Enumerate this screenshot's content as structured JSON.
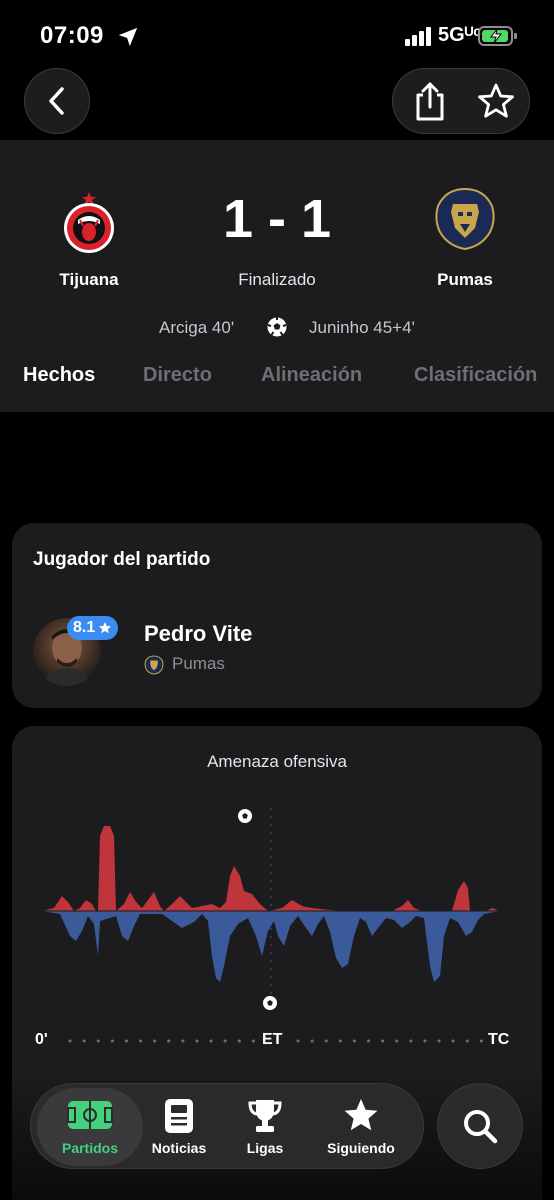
{
  "status_bar": {
    "time": "07:09",
    "network": "5Gᵁᶜ"
  },
  "header": {
    "home_team": {
      "name": "Tijuana",
      "logo_icon": "tijuana-crest-icon"
    },
    "away_team": {
      "name": "Pumas",
      "logo_icon": "pumas-crest-icon"
    },
    "score": "1 - 1",
    "status": "Finalizado",
    "home_scorer": "Arciga 40'",
    "away_scorer": "Juninho 45+4'"
  },
  "tabs": [
    {
      "label": "Hechos",
      "active": true
    },
    {
      "label": "Directo",
      "active": false
    },
    {
      "label": "Alineación",
      "active": false
    },
    {
      "label": "Clasificación",
      "active": false
    }
  ],
  "player_of_match": {
    "title": "Jugador del partido",
    "rating": "8.1",
    "name": "Pedro Vite",
    "team": "Pumas"
  },
  "momentum": {
    "title": "Amenaza ofensiva",
    "start_label": "0'",
    "half_label": "ET",
    "end_label": "TC",
    "colors": {
      "home": "#c0343b",
      "away": "#3b5a9a"
    }
  },
  "nav": {
    "items": [
      {
        "label": "Partidos",
        "icon": "pitch-icon",
        "active": true
      },
      {
        "label": "Noticias",
        "icon": "news-icon",
        "active": false
      },
      {
        "label": "Ligas",
        "icon": "trophy-icon",
        "active": false
      },
      {
        "label": "Siguiendo",
        "icon": "star-icon",
        "active": false
      }
    ],
    "search_icon": "search-icon"
  }
}
